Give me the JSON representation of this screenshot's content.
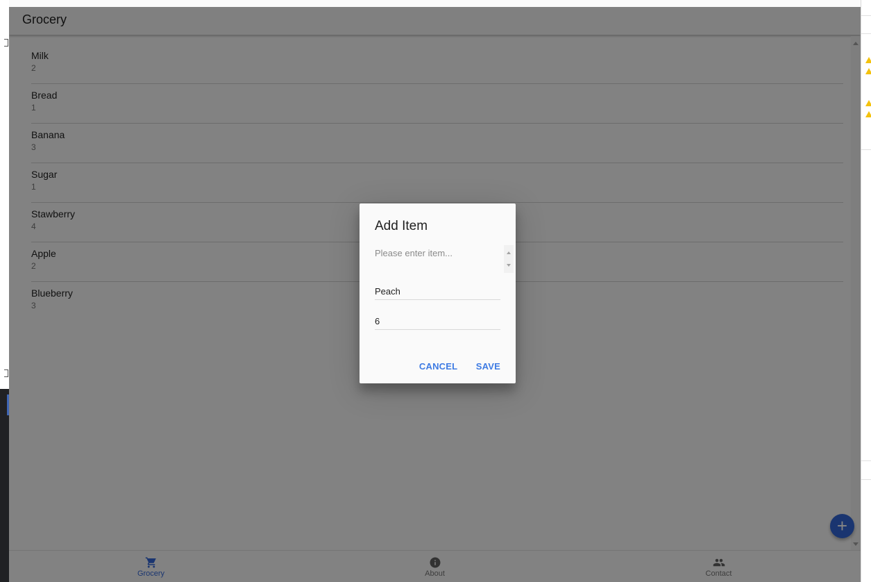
{
  "app": {
    "title": "Grocery"
  },
  "items": [
    {
      "name": "Milk",
      "qty": "2"
    },
    {
      "name": "Bread",
      "qty": "1"
    },
    {
      "name": "Banana",
      "qty": "3"
    },
    {
      "name": "Sugar",
      "qty": "1"
    },
    {
      "name": "Stawberry",
      "qty": "4"
    },
    {
      "name": "Apple",
      "qty": "2"
    },
    {
      "name": "Blueberry",
      "qty": "3"
    }
  ],
  "fab": {
    "icon": "plus-icon",
    "label": "+"
  },
  "bottom_nav": [
    {
      "label": "Grocery",
      "icon": "cart-icon",
      "active": true
    },
    {
      "label": "About",
      "icon": "info-icon",
      "active": false
    },
    {
      "label": "Contact",
      "icon": "contacts-icon",
      "active": false
    }
  ],
  "dialog": {
    "title": "Add Item",
    "prompt": "Please enter item...",
    "item_value": "Peach",
    "quantity_value": "6",
    "cancel_label": "CANCEL",
    "save_label": "SAVE"
  },
  "colors": {
    "accent": "#3367d6",
    "button_text": "#3e7be3",
    "warning": "#f4c20d"
  }
}
